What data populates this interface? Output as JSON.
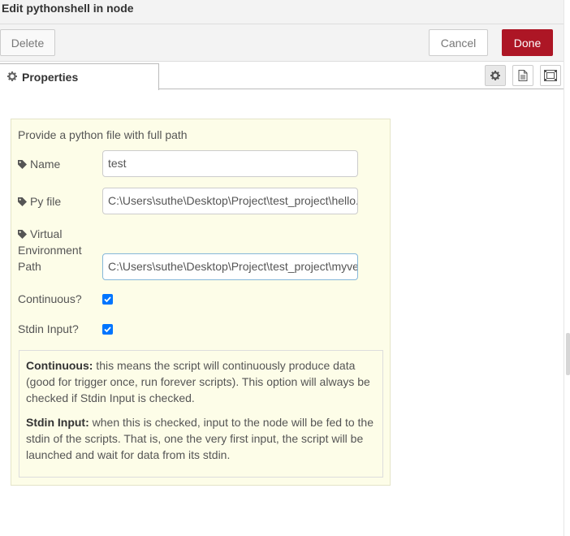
{
  "dialog": {
    "title": "Edit pythonshell in node"
  },
  "toolbar": {
    "delete_label": "Delete",
    "cancel_label": "Cancel",
    "done_label": "Done"
  },
  "tabs": {
    "properties_label": "Properties"
  },
  "form": {
    "heading": "Provide a python file with full path",
    "name": {
      "label": "Name",
      "value": "test"
    },
    "pyfile": {
      "label": "Py file",
      "value": "C:\\Users\\suthe\\Desktop\\Project\\test_project\\hello.py"
    },
    "venv": {
      "label_line1": "Virtual",
      "label_line2": "Environment",
      "label_line3": "Path",
      "value": "C:\\Users\\suthe\\Desktop\\Project\\test_project\\myvenv"
    },
    "continuous": {
      "label": "Continuous?",
      "checked": true
    },
    "stdin": {
      "label": "Stdin Input?",
      "checked": true
    }
  },
  "help": {
    "continuous_title": "Continuous:",
    "continuous_text": " this means the script will continuously produce data (good for trigger once, run forever scripts). This option will always be checked if Stdin Input is checked.",
    "stdin_title": "Stdin Input:",
    "stdin_text": " when this is checked, input to the node will be fed to the stdin of the scripts. That is, one the very first input, the script will be launched and wait for data from its stdin."
  },
  "colors": {
    "done_bg": "#ad1625",
    "panel_bg": "#fdfde8",
    "checkbox": "#0075ff"
  },
  "icons": {
    "tab": "gear-icon",
    "field": "tag-icon",
    "tray_buttons": [
      "gear-icon",
      "document-icon",
      "frame-icon"
    ]
  }
}
